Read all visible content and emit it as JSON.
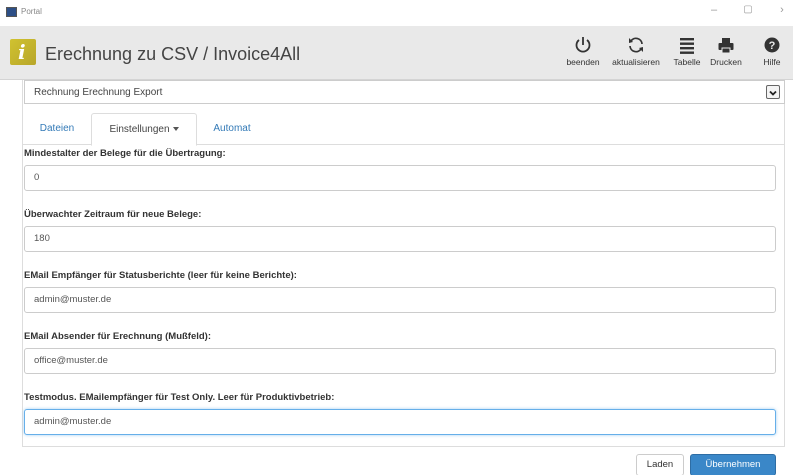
{
  "window": {
    "title": "Portal",
    "minimize": "–",
    "restore": "▢",
    "close": "›"
  },
  "header": {
    "logo_letter": "i",
    "title": "Erechnung zu CSV / Invoice4All",
    "toolbar": [
      {
        "label": "beenden",
        "icon": "power-icon"
      },
      {
        "label": "aktualisieren",
        "icon": "refresh-icon"
      },
      {
        "label": "Tabelle",
        "icon": "list-icon"
      },
      {
        "label": "Drucken",
        "icon": "print-icon"
      },
      {
        "label": "Hilfe",
        "icon": "help-icon"
      }
    ]
  },
  "selector": {
    "value": "Rechnung Erechnung Export"
  },
  "tabs": [
    {
      "label": "Dateien",
      "active": false
    },
    {
      "label": "Einstellungen",
      "active": true
    },
    {
      "label": "Automat",
      "active": false
    }
  ],
  "form": {
    "fields": [
      {
        "label": "Mindestalter der Belege für die Übertragung:",
        "value": "0"
      },
      {
        "label": "Überwachter Zeitraum für neue Belege:",
        "value": "180"
      },
      {
        "label": "EMail Empfänger für Statusberichte (leer für keine Berichte):",
        "value": "admin@muster.de"
      },
      {
        "label": "EMail Absender für Erechnung (Mußfeld):",
        "value": "office@muster.de"
      },
      {
        "label": "Testmodus. EMailempfänger für Test Only. Leer für Produktivbetrieb:",
        "value": "admin@muster.de"
      }
    ]
  },
  "footer": {
    "load_label": "Laden",
    "apply_label": "Übernehmen"
  },
  "colors": {
    "accent": "#3a87c8",
    "link": "#337ab7",
    "logo": "#c8b92e"
  }
}
